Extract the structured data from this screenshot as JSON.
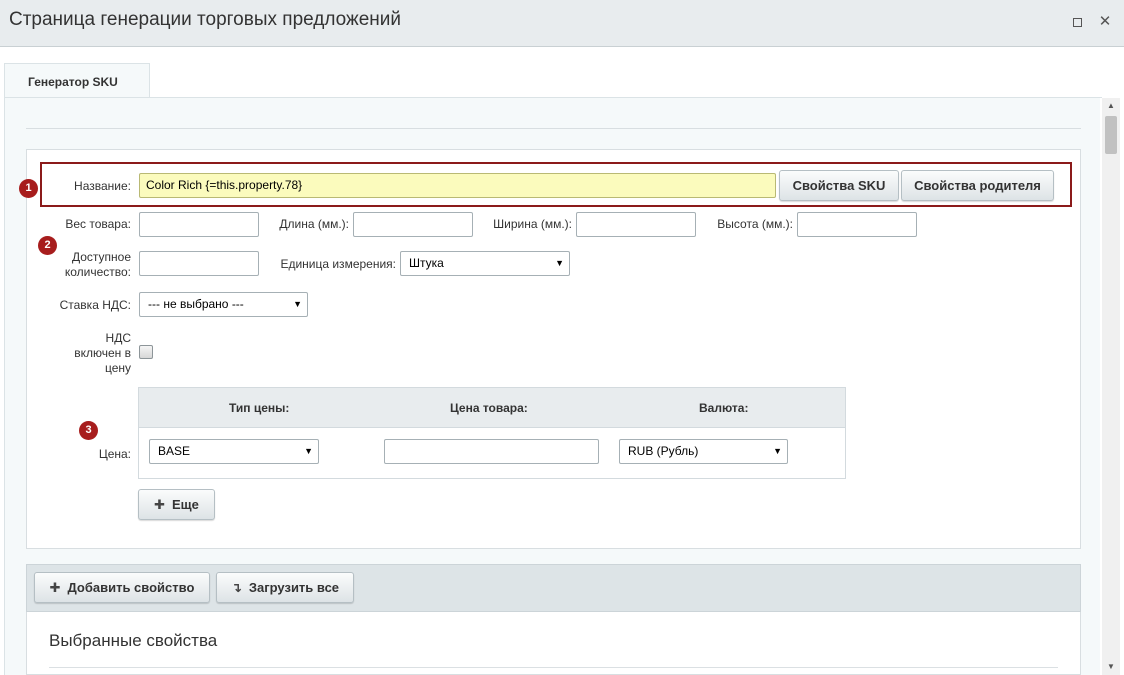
{
  "window": {
    "title": "Страница генерации торговых предложений",
    "maximize_icon": "maximize-icon",
    "close_icon": "close-icon",
    "close_glyph": "✕"
  },
  "tabs": [
    {
      "label": "Генератор SKU",
      "active": true
    }
  ],
  "form": {
    "name": {
      "label": "Название:",
      "value": "Color Rich {=this.property.78}",
      "sku_props_button": "Свойства SKU",
      "parent_props_button": "Свойства родителя"
    },
    "weight_label": "Вес товара:",
    "length_label": "Длина (мм.):",
    "width_label": "Ширина (мм.):",
    "height_label": "Высота (мм.):",
    "quantity_label_line1": "Доступное",
    "quantity_label_line2": "количество:",
    "unit_label": "Единица измерения:",
    "unit_value": "Штука",
    "vat_label": "Ставка НДС:",
    "vat_value": "--- не выбрано ---",
    "vat_included_line1": "НДС",
    "vat_included_line2": "включен в",
    "vat_included_line3": "цену",
    "vat_included_checked": false,
    "price": {
      "label": "Цена:",
      "col_type": "Тип цены:",
      "col_price": "Цена товара:",
      "col_currency": "Валюта:",
      "type_value": "BASE",
      "price_value": "",
      "currency_value": "RUB (Рубль)",
      "more_button": "Еще"
    }
  },
  "annotations": [
    "1",
    "2",
    "3"
  ],
  "annotation_color": "#a71d1d",
  "toolbar": {
    "add_property_button": "Добавить свойство",
    "load_all_button": "Загрузить все"
  },
  "selected_properties": {
    "title": "Выбранные свойства"
  }
}
